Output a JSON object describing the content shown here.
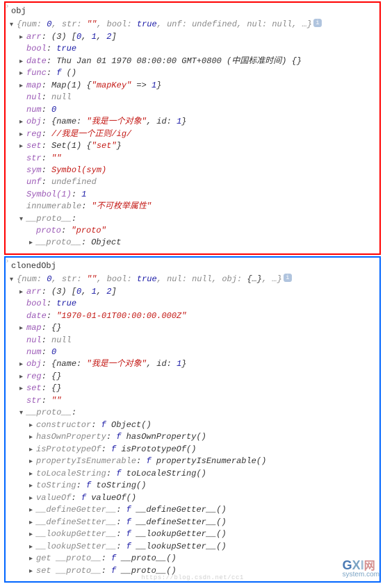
{
  "headers": {
    "obj": "obj",
    "clonedObj": "clonedObj"
  },
  "panel1": {
    "summary_open": "{",
    "summary_pairs": [
      {
        "k": "num",
        "v": "0",
        "cls": "num"
      },
      {
        "k": "str",
        "v": "\"\"",
        "cls": "str"
      },
      {
        "k": "bool",
        "v": "true",
        "cls": "bool"
      },
      {
        "k": "unf",
        "v": "undefined",
        "cls": "null"
      },
      {
        "k": "nul",
        "v": "null",
        "cls": "null"
      },
      {
        "k": "",
        "v": "…",
        "cls": "dim"
      }
    ],
    "summary_close": "}",
    "rows": [
      {
        "indent": 1,
        "arrow": "closed",
        "k": "arr",
        "kcls": "key-purple",
        "suffix": ": (3) ",
        "vals": [
          {
            "t": "[",
            "cls": ""
          },
          {
            "t": "0",
            "cls": "num"
          },
          {
            "t": ", ",
            "cls": ""
          },
          {
            "t": "1",
            "cls": "num"
          },
          {
            "t": ", ",
            "cls": ""
          },
          {
            "t": "2",
            "cls": "num"
          },
          {
            "t": "]",
            "cls": ""
          }
        ]
      },
      {
        "indent": 1,
        "arrow": "blank",
        "k": "bool",
        "kcls": "key-purple",
        "suffix": ": ",
        "vals": [
          {
            "t": "true",
            "cls": "bool"
          }
        ]
      },
      {
        "indent": 1,
        "arrow": "closed",
        "k": "date",
        "kcls": "key-purple",
        "suffix": ": ",
        "vals": [
          {
            "t": "Thu Jan 01 1970 08:00:00 GMT+0800 (中国标准时间) {}",
            "cls": "key-plain"
          }
        ]
      },
      {
        "indent": 1,
        "arrow": "closed",
        "k": "func",
        "kcls": "key-purple",
        "suffix": ": ",
        "vals": [
          {
            "t": "f ",
            "cls": "func-f"
          },
          {
            "t": "()",
            "cls": "key-plain"
          }
        ]
      },
      {
        "indent": 1,
        "arrow": "closed",
        "k": "map",
        "kcls": "key-purple",
        "suffix": ": ",
        "vals": [
          {
            "t": "Map(1) {",
            "cls": "key-plain"
          },
          {
            "t": "\"mapKey\"",
            "cls": "str"
          },
          {
            "t": " => ",
            "cls": "key-plain"
          },
          {
            "t": "1",
            "cls": "num"
          },
          {
            "t": "}",
            "cls": "key-plain"
          }
        ]
      },
      {
        "indent": 1,
        "arrow": "blank",
        "k": "nul",
        "kcls": "key-purple",
        "suffix": ": ",
        "vals": [
          {
            "t": "null",
            "cls": "null"
          }
        ]
      },
      {
        "indent": 1,
        "arrow": "blank",
        "k": "num",
        "kcls": "key-purple",
        "suffix": ": ",
        "vals": [
          {
            "t": "0",
            "cls": "num"
          }
        ]
      },
      {
        "indent": 1,
        "arrow": "closed",
        "k": "obj",
        "kcls": "key-purple",
        "suffix": ": ",
        "vals": [
          {
            "t": "{name: ",
            "cls": "key-plain"
          },
          {
            "t": "\"我是一个对象\"",
            "cls": "str"
          },
          {
            "t": ", id: ",
            "cls": "key-plain"
          },
          {
            "t": "1",
            "cls": "num"
          },
          {
            "t": "}",
            "cls": "key-plain"
          }
        ]
      },
      {
        "indent": 1,
        "arrow": "closed",
        "k": "reg",
        "kcls": "key-purple",
        "suffix": ": ",
        "vals": [
          {
            "t": "//我是一个正则/ig/",
            "cls": "str"
          }
        ]
      },
      {
        "indent": 1,
        "arrow": "closed",
        "k": "set",
        "kcls": "key-purple",
        "suffix": ": ",
        "vals": [
          {
            "t": "Set(1) {",
            "cls": "key-plain"
          },
          {
            "t": "\"set\"",
            "cls": "str"
          },
          {
            "t": "}",
            "cls": "key-plain"
          }
        ]
      },
      {
        "indent": 1,
        "arrow": "blank",
        "k": "str",
        "kcls": "key-purple",
        "suffix": ": ",
        "vals": [
          {
            "t": "\"\"",
            "cls": "str"
          }
        ]
      },
      {
        "indent": 1,
        "arrow": "blank",
        "k": "sym",
        "kcls": "key-purple",
        "suffix": ": ",
        "vals": [
          {
            "t": "Symbol(sym)",
            "cls": "str"
          }
        ]
      },
      {
        "indent": 1,
        "arrow": "blank",
        "k": "unf",
        "kcls": "key-purple",
        "suffix": ": ",
        "vals": [
          {
            "t": "undefined",
            "cls": "null"
          }
        ]
      },
      {
        "indent": 1,
        "arrow": "blank",
        "k": "Symbol(1)",
        "kcls": "key-purple",
        "suffix": ": ",
        "vals": [
          {
            "t": "1",
            "cls": "num"
          }
        ]
      },
      {
        "indent": 1,
        "arrow": "blank",
        "k": "innumerable",
        "kcls": "dim",
        "suffix": ": ",
        "vals": [
          {
            "t": "\"不可枚举属性\"",
            "cls": "str"
          }
        ]
      },
      {
        "indent": 1,
        "arrow": "open",
        "k": "__proto__",
        "kcls": "dim",
        "suffix": ":",
        "vals": []
      },
      {
        "indent": 2,
        "arrow": "blank",
        "k": "proto",
        "kcls": "key-purple",
        "suffix": ": ",
        "vals": [
          {
            "t": "\"proto\"",
            "cls": "str"
          }
        ]
      },
      {
        "indent": 2,
        "arrow": "closed",
        "k": "__proto__",
        "kcls": "dim",
        "suffix": ": ",
        "vals": [
          {
            "t": "Object",
            "cls": "key-plain"
          }
        ]
      }
    ]
  },
  "panel2": {
    "summary_open": "{",
    "summary_pairs": [
      {
        "k": "num",
        "v": "0",
        "cls": "num"
      },
      {
        "k": "str",
        "v": "\"\"",
        "cls": "str"
      },
      {
        "k": "bool",
        "v": "true",
        "cls": "bool"
      },
      {
        "k": "nul",
        "v": "null",
        "cls": "null"
      },
      {
        "k": "obj",
        "v": "{…}",
        "cls": "key-plain"
      },
      {
        "k": "",
        "v": "…",
        "cls": "dim"
      }
    ],
    "summary_close": "}",
    "rows": [
      {
        "indent": 1,
        "arrow": "closed",
        "k": "arr",
        "kcls": "key-purple",
        "suffix": ": (3) ",
        "vals": [
          {
            "t": "[",
            "cls": ""
          },
          {
            "t": "0",
            "cls": "num"
          },
          {
            "t": ", ",
            "cls": ""
          },
          {
            "t": "1",
            "cls": "num"
          },
          {
            "t": ", ",
            "cls": ""
          },
          {
            "t": "2",
            "cls": "num"
          },
          {
            "t": "]",
            "cls": ""
          }
        ]
      },
      {
        "indent": 1,
        "arrow": "blank",
        "k": "bool",
        "kcls": "key-purple",
        "suffix": ": ",
        "vals": [
          {
            "t": "true",
            "cls": "bool"
          }
        ]
      },
      {
        "indent": 1,
        "arrow": "blank",
        "k": "date",
        "kcls": "key-purple",
        "suffix": ": ",
        "vals": [
          {
            "t": "\"1970-01-01T00:00:00.000Z\"",
            "cls": "str"
          }
        ]
      },
      {
        "indent": 1,
        "arrow": "closed",
        "k": "map",
        "kcls": "key-purple",
        "suffix": ": ",
        "vals": [
          {
            "t": "{}",
            "cls": "key-plain"
          }
        ]
      },
      {
        "indent": 1,
        "arrow": "blank",
        "k": "nul",
        "kcls": "key-purple",
        "suffix": ": ",
        "vals": [
          {
            "t": "null",
            "cls": "null"
          }
        ]
      },
      {
        "indent": 1,
        "arrow": "blank",
        "k": "num",
        "kcls": "key-purple",
        "suffix": ": ",
        "vals": [
          {
            "t": "0",
            "cls": "num"
          }
        ]
      },
      {
        "indent": 1,
        "arrow": "closed",
        "k": "obj",
        "kcls": "key-purple",
        "suffix": ": ",
        "vals": [
          {
            "t": "{name: ",
            "cls": "key-plain"
          },
          {
            "t": "\"我是一个对象\"",
            "cls": "str"
          },
          {
            "t": ", id: ",
            "cls": "key-plain"
          },
          {
            "t": "1",
            "cls": "num"
          },
          {
            "t": "}",
            "cls": "key-plain"
          }
        ]
      },
      {
        "indent": 1,
        "arrow": "closed",
        "k": "reg",
        "kcls": "key-purple",
        "suffix": ": ",
        "vals": [
          {
            "t": "{}",
            "cls": "key-plain"
          }
        ]
      },
      {
        "indent": 1,
        "arrow": "closed",
        "k": "set",
        "kcls": "key-purple",
        "suffix": ": ",
        "vals": [
          {
            "t": "{}",
            "cls": "key-plain"
          }
        ]
      },
      {
        "indent": 1,
        "arrow": "blank",
        "k": "str",
        "kcls": "key-purple",
        "suffix": ": ",
        "vals": [
          {
            "t": "\"\"",
            "cls": "str"
          }
        ]
      },
      {
        "indent": 1,
        "arrow": "open",
        "k": "__proto__",
        "kcls": "dim",
        "suffix": ":",
        "vals": []
      },
      {
        "indent": 2,
        "arrow": "closed",
        "k": "constructor",
        "kcls": "dim",
        "suffix": ": ",
        "vals": [
          {
            "t": "f ",
            "cls": "func-f"
          },
          {
            "t": "Object()",
            "cls": "key-plain"
          }
        ]
      },
      {
        "indent": 2,
        "arrow": "closed",
        "k": "hasOwnProperty",
        "kcls": "dim",
        "suffix": ": ",
        "vals": [
          {
            "t": "f ",
            "cls": "func-f"
          },
          {
            "t": "hasOwnProperty()",
            "cls": "key-plain"
          }
        ]
      },
      {
        "indent": 2,
        "arrow": "closed",
        "k": "isPrototypeOf",
        "kcls": "dim",
        "suffix": ": ",
        "vals": [
          {
            "t": "f ",
            "cls": "func-f"
          },
          {
            "t": "isPrototypeOf()",
            "cls": "key-plain"
          }
        ]
      },
      {
        "indent": 2,
        "arrow": "closed",
        "k": "propertyIsEnumerable",
        "kcls": "dim",
        "suffix": ": ",
        "vals": [
          {
            "t": "f ",
            "cls": "func-f"
          },
          {
            "t": "propertyIsEnumerable()",
            "cls": "key-plain"
          }
        ]
      },
      {
        "indent": 2,
        "arrow": "closed",
        "k": "toLocaleString",
        "kcls": "dim",
        "suffix": ": ",
        "vals": [
          {
            "t": "f ",
            "cls": "func-f"
          },
          {
            "t": "toLocaleString()",
            "cls": "key-plain"
          }
        ]
      },
      {
        "indent": 2,
        "arrow": "closed",
        "k": "toString",
        "kcls": "dim",
        "suffix": ": ",
        "vals": [
          {
            "t": "f ",
            "cls": "func-f"
          },
          {
            "t": "toString()",
            "cls": "key-plain"
          }
        ]
      },
      {
        "indent": 2,
        "arrow": "closed",
        "k": "valueOf",
        "kcls": "dim",
        "suffix": ": ",
        "vals": [
          {
            "t": "f ",
            "cls": "func-f"
          },
          {
            "t": "valueOf()",
            "cls": "key-plain"
          }
        ]
      },
      {
        "indent": 2,
        "arrow": "closed",
        "k": "__defineGetter__",
        "kcls": "dim",
        "suffix": ": ",
        "vals": [
          {
            "t": "f ",
            "cls": "func-f"
          },
          {
            "t": "__defineGetter__()",
            "cls": "key-plain"
          }
        ]
      },
      {
        "indent": 2,
        "arrow": "closed",
        "k": "__defineSetter__",
        "kcls": "dim",
        "suffix": ": ",
        "vals": [
          {
            "t": "f ",
            "cls": "func-f"
          },
          {
            "t": "__defineSetter__()",
            "cls": "key-plain"
          }
        ]
      },
      {
        "indent": 2,
        "arrow": "closed",
        "k": "__lookupGetter__",
        "kcls": "dim",
        "suffix": ": ",
        "vals": [
          {
            "t": "f ",
            "cls": "func-f"
          },
          {
            "t": "__lookupGetter__()",
            "cls": "key-plain"
          }
        ]
      },
      {
        "indent": 2,
        "arrow": "closed",
        "k": "__lookupSetter__",
        "kcls": "dim",
        "suffix": ": ",
        "vals": [
          {
            "t": "f ",
            "cls": "func-f"
          },
          {
            "t": "__lookupSetter__()",
            "cls": "key-plain"
          }
        ]
      },
      {
        "indent": 2,
        "arrow": "closed",
        "k": "get __proto__",
        "kcls": "dim",
        "suffix": ": ",
        "vals": [
          {
            "t": "f ",
            "cls": "func-f"
          },
          {
            "t": "__proto__()",
            "cls": "key-plain"
          }
        ]
      },
      {
        "indent": 2,
        "arrow": "closed",
        "k": "set __proto__",
        "kcls": "dim",
        "suffix": ": ",
        "vals": [
          {
            "t": "f ",
            "cls": "func-f"
          },
          {
            "t": "__proto__()",
            "cls": "key-plain"
          }
        ]
      }
    ]
  },
  "watermark": "https://blog.csdn.net/cc1",
  "logo": {
    "g": "G",
    "x": "X",
    "i": "I",
    "w": "网",
    "sub": "system.com"
  }
}
